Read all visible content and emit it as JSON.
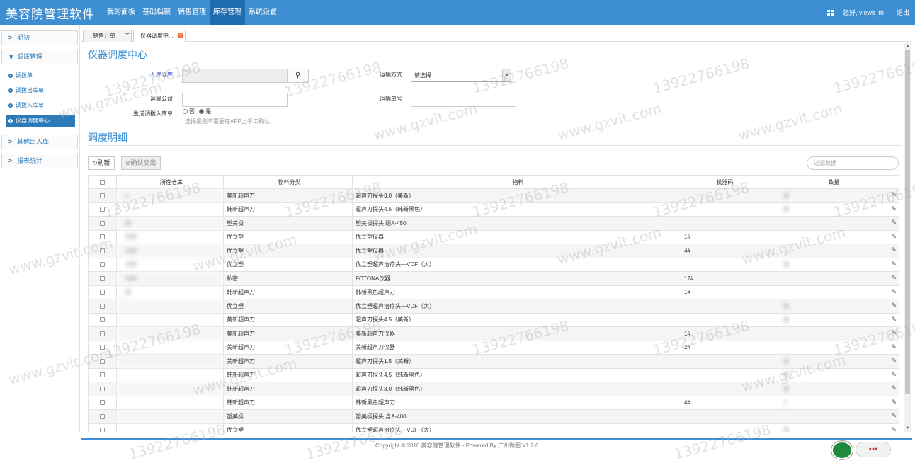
{
  "app": {
    "title": "美容院管理软件"
  },
  "topnav": {
    "items": [
      "我的面板",
      "基础档案",
      "销售管理",
      "库存管理",
      "系统设置"
    ],
    "active": "库存管理"
  },
  "topright": {
    "greeting": "您好, viewit_fh",
    "logout": "退出",
    "grid_icon": "grid-icon"
  },
  "sidebar": {
    "groups": [
      {
        "label": "期初",
        "expanded": false
      },
      {
        "label": "调拨管理",
        "expanded": true,
        "items": [
          "调拨单",
          "调拨出库单",
          "调拨入库单",
          "仪器调度中心"
        ],
        "active": "仪器调度中心"
      },
      {
        "label": "其他出入库",
        "expanded": false
      },
      {
        "label": "报表统计",
        "expanded": false
      }
    ]
  },
  "tabs": [
    {
      "label": "销售开单"
    },
    {
      "label": "仪器调度中..."
    }
  ],
  "page": {
    "title": "仪器调度中心",
    "detail_title": "调度明细"
  },
  "form": {
    "in_warehouse": {
      "label": "入库仓库",
      "value": ""
    },
    "transport_mode": {
      "label": "运输方式",
      "value": "请选择"
    },
    "transport_company": {
      "label": "运输公司",
      "value": ""
    },
    "transport_no": {
      "label": "运输单号",
      "value": ""
    },
    "gen_receipt": {
      "label": "生成调拨入库单",
      "options": [
        "否",
        "是"
      ],
      "selected": "是"
    },
    "hint": "选择是则不需要在APP上手工确认."
  },
  "toolbar": {
    "refresh": "刷新",
    "confirm": "确认交出",
    "filter_placeholder": "过滤数据"
  },
  "table": {
    "headers": [
      "所在仓库",
      "物料分类",
      "物料",
      "机器码",
      "数量"
    ],
    "rows": [
      {
        "warehouse": "o",
        "category": "美新超声刀",
        "material": "超声刀探头3.0（美新）",
        "code": "",
        "qty": "发"
      },
      {
        "warehouse": "",
        "category": "韩新超声刀",
        "material": "超声刀探头4.5（韩新黑色）",
        "code": "",
        "qty": "发"
      },
      {
        "warehouse": "库",
        "category": "塑美极",
        "material": "塑美极探头 眼A-450",
        "code": "",
        "qty": ""
      },
      {
        "warehouse": "仓库",
        "category": "优立塑",
        "material": "优立塑仪器",
        "code": "1#",
        "qty": ""
      },
      {
        "warehouse": "仓库",
        "category": "优立塑",
        "material": "优立塑仪器",
        "code": "4#",
        "qty": ""
      },
      {
        "warehouse": "仓库",
        "category": "优立塑",
        "material": "优立塑超声治疗头—VDF（大）",
        "code": "",
        "qty": "发"
      },
      {
        "warehouse": "仓库",
        "category": "私密",
        "material": "FOTONA仪器",
        "code": "12#",
        "qty": ""
      },
      {
        "warehouse": "库",
        "category": "韩新超声刀",
        "material": "韩新黑色超声刀",
        "code": "1#",
        "qty": ""
      },
      {
        "warehouse": "",
        "category": "优立塑",
        "material": "优立塑超声治疗头—VDF（大）",
        "code": "",
        "qty": "发"
      },
      {
        "warehouse": "",
        "category": "美新超声刀",
        "material": "超声刀探头4.5（美新）",
        "code": "",
        "qty": "发"
      },
      {
        "warehouse": "",
        "category": "美新超声刀",
        "material": "美新超声刀仪器",
        "code": "1#",
        "qty": ""
      },
      {
        "warehouse": "",
        "category": "美新超声刀",
        "material": "美新超声刀仪器",
        "code": "2#",
        "qty": ""
      },
      {
        "warehouse": "",
        "category": "美新超声刀",
        "material": "超声刀探头1.5（美新）",
        "code": "",
        "qty": "发"
      },
      {
        "warehouse": "",
        "category": "韩新超声刀",
        "material": "超声刀探头4.5（韩新黑色）",
        "code": "",
        "qty": "发"
      },
      {
        "warehouse": "",
        "category": "韩新超声刀",
        "material": "超声刀探头3.0（韩新黑色）",
        "code": "",
        "qty": "发"
      },
      {
        "warehouse": "",
        "category": "韩新超声刀",
        "material": "韩新黑色超声刀",
        "code": "4#",
        "qty": "1"
      },
      {
        "warehouse": "",
        "category": "塑美极",
        "material": "塑美极探头 身A-400",
        "code": "",
        "qty": ""
      },
      {
        "warehouse": "",
        "category": "优立塑",
        "material": "优立塑超声治疗头—VDF（大）",
        "code": "",
        "qty": "发"
      }
    ]
  },
  "footer": {
    "copyright": "Copyright © 2016 美容院管理软件 - Powered By 广州微图 V1.2.6"
  },
  "watermark": {
    "url": "www.gzvit.com",
    "phone": "13922766198"
  },
  "colors": {
    "topbar": "#3d8fd1",
    "active_nav": "#1f6cae",
    "link": "#2d7ab8"
  }
}
